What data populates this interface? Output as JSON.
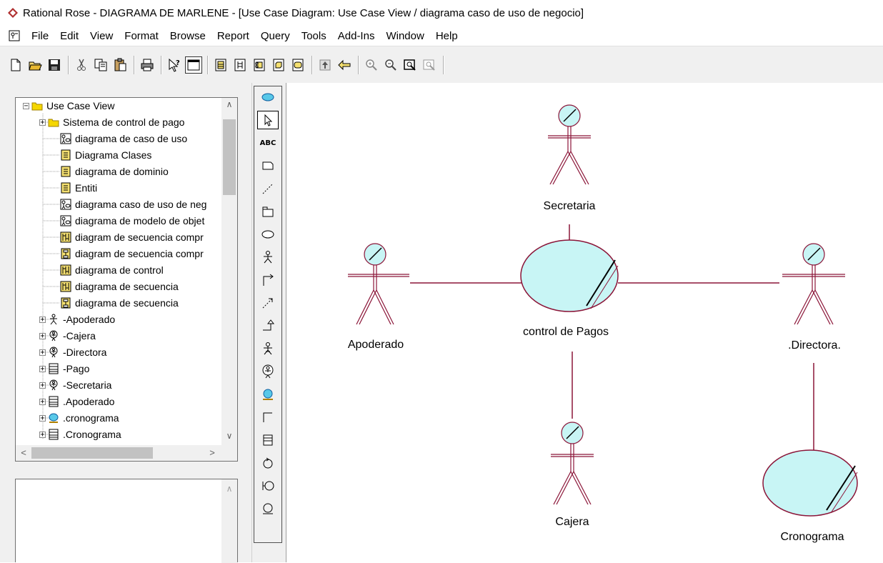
{
  "window": {
    "title": "Rational Rose - DIAGRAMA DE MARLENE - [Use Case Diagram: Use Case View / diagrama caso de uso de negocio]"
  },
  "menu": [
    "File",
    "Edit",
    "View",
    "Format",
    "Browse",
    "Report",
    "Query",
    "Tools",
    "Add-Ins",
    "Window",
    "Help"
  ],
  "toolbar_icons": [
    "new-icon",
    "open-icon",
    "save-icon",
    "cut-icon",
    "copy-icon",
    "paste-icon",
    "print-icon",
    "context-help-icon",
    "view-doc-icon",
    "class-diagram-icon",
    "interaction-diagram-icon",
    "component-diagram-icon",
    "deployment-diagram-icon",
    "state-diagram-icon",
    "browse-parent-icon",
    "browse-previous-icon",
    "zoom-in-icon",
    "zoom-out-icon",
    "fit-in-window-icon",
    "undo-fit-icon"
  ],
  "browser": {
    "root": "Use Case View",
    "items": [
      {
        "label": "Sistema de control de pago",
        "icon": "folder-icon",
        "expandable": true
      },
      {
        "label": "diagrama de caso de uso",
        "icon": "use-case-diagram-icon",
        "expandable": false
      },
      {
        "label": "Diagrama Clases",
        "icon": "class-diagram-icon",
        "expandable": false
      },
      {
        "label": "diagrama de dominio",
        "icon": "class-diagram-icon",
        "expandable": false
      },
      {
        "label": "Entiti",
        "icon": "class-diagram-icon",
        "expandable": false
      },
      {
        "label": "diagrama caso de uso de neg",
        "icon": "use-case-diagram-icon",
        "expandable": false,
        "selected": true
      },
      {
        "label": "diagrama de modelo de objet",
        "icon": "use-case-diagram-icon",
        "expandable": false
      },
      {
        "label": "diagram de secuencia compr",
        "icon": "sequence-diagram-icon",
        "expandable": false
      },
      {
        "label": "diagram de secuencia compr",
        "icon": "collaboration-diagram-icon",
        "expandable": false
      },
      {
        "label": "diagrama de control",
        "icon": "sequence-diagram-icon",
        "expandable": false
      },
      {
        "label": "diagrama de secuencia",
        "icon": "sequence-diagram-icon",
        "expandable": false
      },
      {
        "label": "diagrama de secuencia",
        "icon": "collaboration-diagram-icon",
        "expandable": false
      },
      {
        "label": "-Apoderado",
        "icon": "actor-icon",
        "expandable": true
      },
      {
        "label": "-Cajera",
        "icon": "business-actor-icon",
        "expandable": true
      },
      {
        "label": "-Directora",
        "icon": "business-actor-icon",
        "expandable": true
      },
      {
        "label": "-Pago",
        "icon": "class-icon",
        "expandable": true
      },
      {
        "label": "-Secretaria",
        "icon": "business-actor-icon",
        "expandable": true
      },
      {
        "label": ".Apoderado",
        "icon": "class-icon",
        "expandable": true
      },
      {
        "label": ".cronograma",
        "icon": "business-use-case-icon",
        "expandable": true
      },
      {
        "label": ".Cronograma",
        "icon": "class-icon",
        "expandable": true
      }
    ]
  },
  "toolbox": {
    "items": [
      "use-case-icon",
      "selection-arrow-icon",
      "text-tool-icon",
      "note-icon",
      "anchor-note-icon",
      "package-icon",
      "use-case-tool-icon",
      "actor-tool-icon",
      "unidirectional-association-icon",
      "dependency-icon",
      "generalization-icon",
      "business-actor-tool-icon",
      "business-worker-icon",
      "business-use-case-tool-icon",
      "business-use-case-realization-icon",
      "business-entity-icon",
      "business-event-icon",
      "boundary-icon",
      "control-icon"
    ],
    "abc_label": "ABC"
  },
  "diagram": {
    "actors": [
      "Secretaria",
      "Apoderado",
      ".Directora.",
      "Cajera"
    ],
    "use_cases": [
      "control de Pagos",
      "Cronograma"
    ],
    "colors": {
      "line": "#8b1538",
      "fill": "#c8f5f5",
      "outline": "#8b1538"
    }
  }
}
